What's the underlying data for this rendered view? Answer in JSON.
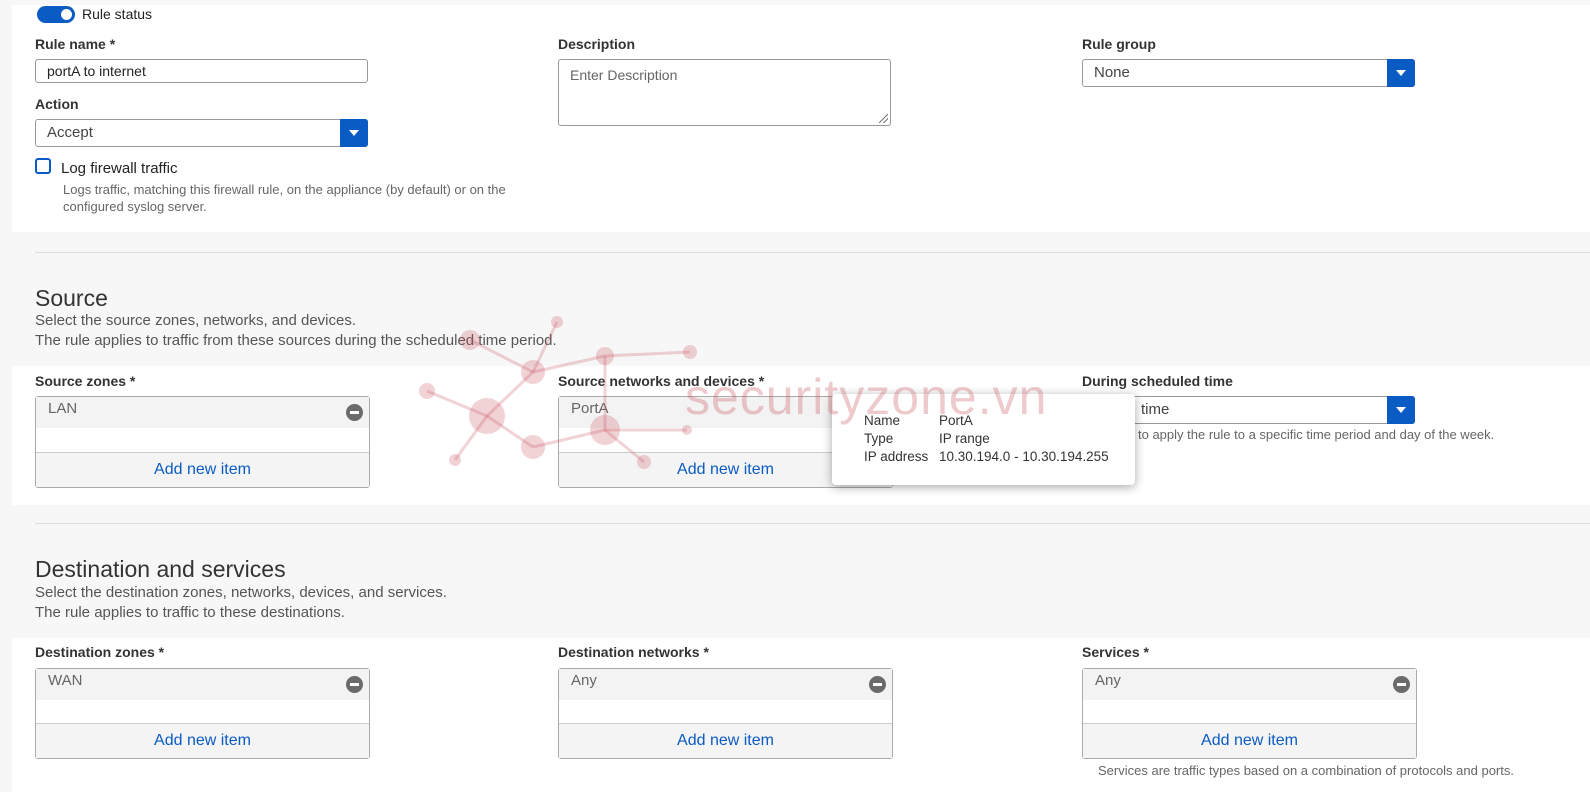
{
  "rule": {
    "status_label": "Rule status",
    "name_label": "Rule name *",
    "name_value": "portA to internet",
    "action_label": "Action",
    "action_value": "Accept",
    "log_label": "Log firewall traffic",
    "log_hint": "Logs traffic, matching this firewall rule, on the appliance (by default) or on the configured syslog server.",
    "description_label": "Description",
    "description_placeholder": "Enter Description",
    "group_label": "Rule group",
    "group_value": "None"
  },
  "source": {
    "title": "Source",
    "desc_line1": "Select the source zones, networks, and devices.",
    "desc_line2": "The rule applies to traffic from these sources during the scheduled time period.",
    "zones_label": "Source zones *",
    "zones_item": "LAN",
    "networks_label": "Source networks and devices *",
    "networks_item": "PortA",
    "schedule_label": "During scheduled time",
    "schedule_value": "time",
    "schedule_hint": "to apply the rule to a specific time period and day of the week.",
    "add_label": "Add new item"
  },
  "tooltip": {
    "name_key": "Name",
    "name_val": "PortA",
    "type_key": "Type",
    "type_val": "IP range",
    "ip_key": "IP address",
    "ip_val": "10.30.194.0 - 10.30.194.255"
  },
  "destination": {
    "title": "Destination and services",
    "desc_line1": "Select the destination zones, networks, devices, and services.",
    "desc_line2": "The rule applies to traffic to these destinations.",
    "zones_label": "Destination zones *",
    "zones_item": "WAN",
    "networks_label": "Destination networks *",
    "networks_item": "Any",
    "services_label": "Services *",
    "services_item": "Any",
    "services_hint": "Services are traffic types based on a combination of protocols and ports.",
    "add_label": "Add new item"
  },
  "watermark": "securityzone.vn",
  "colors": {
    "accent": "#0a5bc4",
    "toggle": "#0a5bc4"
  }
}
